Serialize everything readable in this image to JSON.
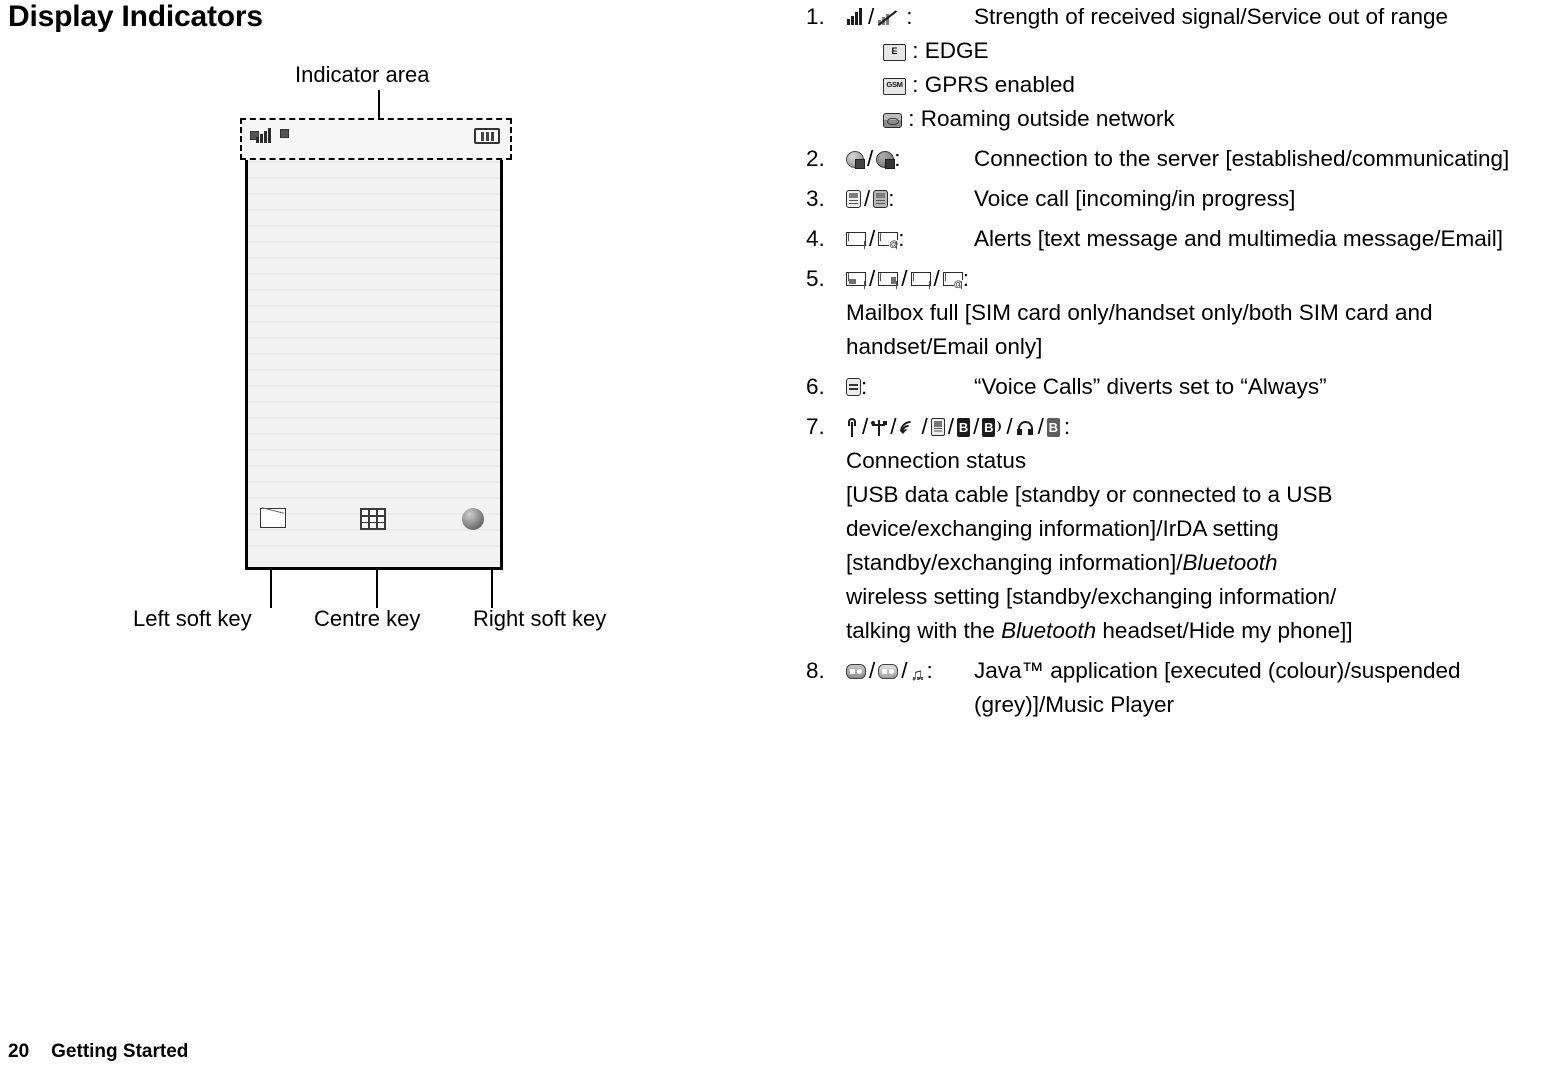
{
  "document": {
    "page_title": "Display Indicators",
    "footer": {
      "page_number": "20",
      "section": "Getting Started"
    }
  },
  "diagram": {
    "indicator_area_label": "Indicator area",
    "captions": {
      "left_soft_key": "Left soft key",
      "centre_key": "Centre key",
      "right_soft_key": "Right soft key"
    },
    "icons": {
      "signal": "signal-strength-icon",
      "battery": "battery-icon",
      "left_soft": "envelope-icon",
      "centre": "grid-menu-icon",
      "right_soft": "circle-icon"
    }
  },
  "indicator_list": [
    {
      "num": "1.",
      "glyphs": [
        "signal-strength-icon",
        "out-of-range-icon"
      ],
      "separator": "/",
      "colon": ":",
      "desc": "Strength of received signal/Service out of range",
      "sub_items": [
        {
          "glyph": "edge-tag-icon",
          "label": ": EDGE"
        },
        {
          "glyph": "gprs-tag-icon",
          "label": ": GPRS enabled"
        },
        {
          "glyph": "roaming-icon",
          "label": ": Roaming outside network"
        }
      ]
    },
    {
      "num": "2.",
      "glyphs": [
        "server-connected-icon",
        "server-communicating-icon"
      ],
      "colon": ":",
      "desc": "Connection to the server [established/communicating]"
    },
    {
      "num": "3.",
      "glyphs": [
        "voice-call-incoming-icon",
        "voice-call-inprogress-icon"
      ],
      "colon": ":",
      "desc": "Voice call [incoming/in progress]"
    },
    {
      "num": "4.",
      "glyphs": [
        "message-alert-icon",
        "email-alert-icon"
      ],
      "colon": ":",
      "desc": "Alerts [text message and multimedia message/Email]"
    },
    {
      "num": "5.",
      "glyphs": [
        "mailbox-full-sim-icon",
        "mailbox-full-handset-icon",
        "mailbox-full-both-icon",
        "mailbox-full-email-icon"
      ],
      "colon": ":",
      "desc": "Mailbox full [SIM card only/handset only/both SIM card and handset/Email only]"
    },
    {
      "num": "6.",
      "glyphs": [
        "call-divert-icon"
      ],
      "colon": ":",
      "desc": "“Voice Calls” diverts set to “Always”"
    },
    {
      "num": "7.",
      "glyphs": [
        "usb-standby-icon",
        "usb-connected-icon",
        "irda-standby-icon",
        "irda-exchanging-icon",
        "bluetooth-standby-icon",
        "bluetooth-exchanging-icon",
        "bluetooth-headset-icon",
        "bluetooth-hide-phone-icon"
      ],
      "colon": ":",
      "desc_lines": [
        "Connection status",
        "[USB data cable [standby or connected to a USB",
        "device/exchanging information]/IrDA setting",
        "[standby/exchanging information]/Bluetooth",
        "wireless setting [standby/exchanging information/",
        "talking with the Bluetooth headset/Hide my phone]]"
      ],
      "italic_words": [
        "Bluetooth"
      ]
    },
    {
      "num": "8.",
      "glyphs": [
        "java-colour-icon",
        "java-grey-icon",
        "music-player-icon"
      ],
      "colon": ":",
      "desc": "Java™ application [executed (colour)/suspended (grey)]/Music Player"
    }
  ]
}
